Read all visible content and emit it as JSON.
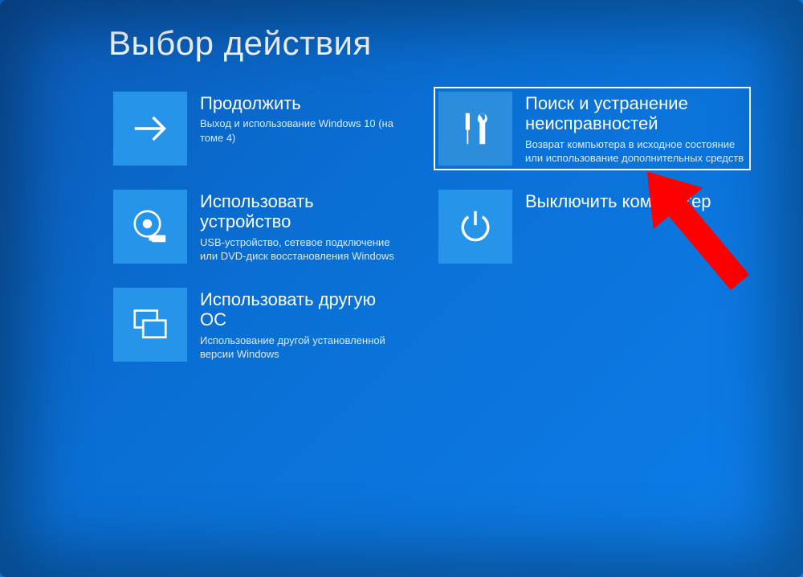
{
  "page": {
    "title": "Выбор действия"
  },
  "tiles": {
    "continue": {
      "title": "Продолжить",
      "desc": "Выход и использование Windows 10 (на томе 4)"
    },
    "troubleshoot": {
      "title": "Поиск и устранение неисправностей",
      "desc": "Возврат компьютера в исходное состояние или использование дополнительных средств"
    },
    "useDevice": {
      "title": "Использовать устройство",
      "desc": "USB-устройство, сетевое подключение или DVD-диск восстановления Windows"
    },
    "turnOff": {
      "title": "Выключить компьютер",
      "desc": ""
    },
    "useOtherOs": {
      "title": "Использовать другую ОС",
      "desc": "Использование другой установленной версии Windows"
    }
  },
  "colors": {
    "tileBg": "#2694e8",
    "border": "#ffffff",
    "arrow": "#ff0000"
  }
}
